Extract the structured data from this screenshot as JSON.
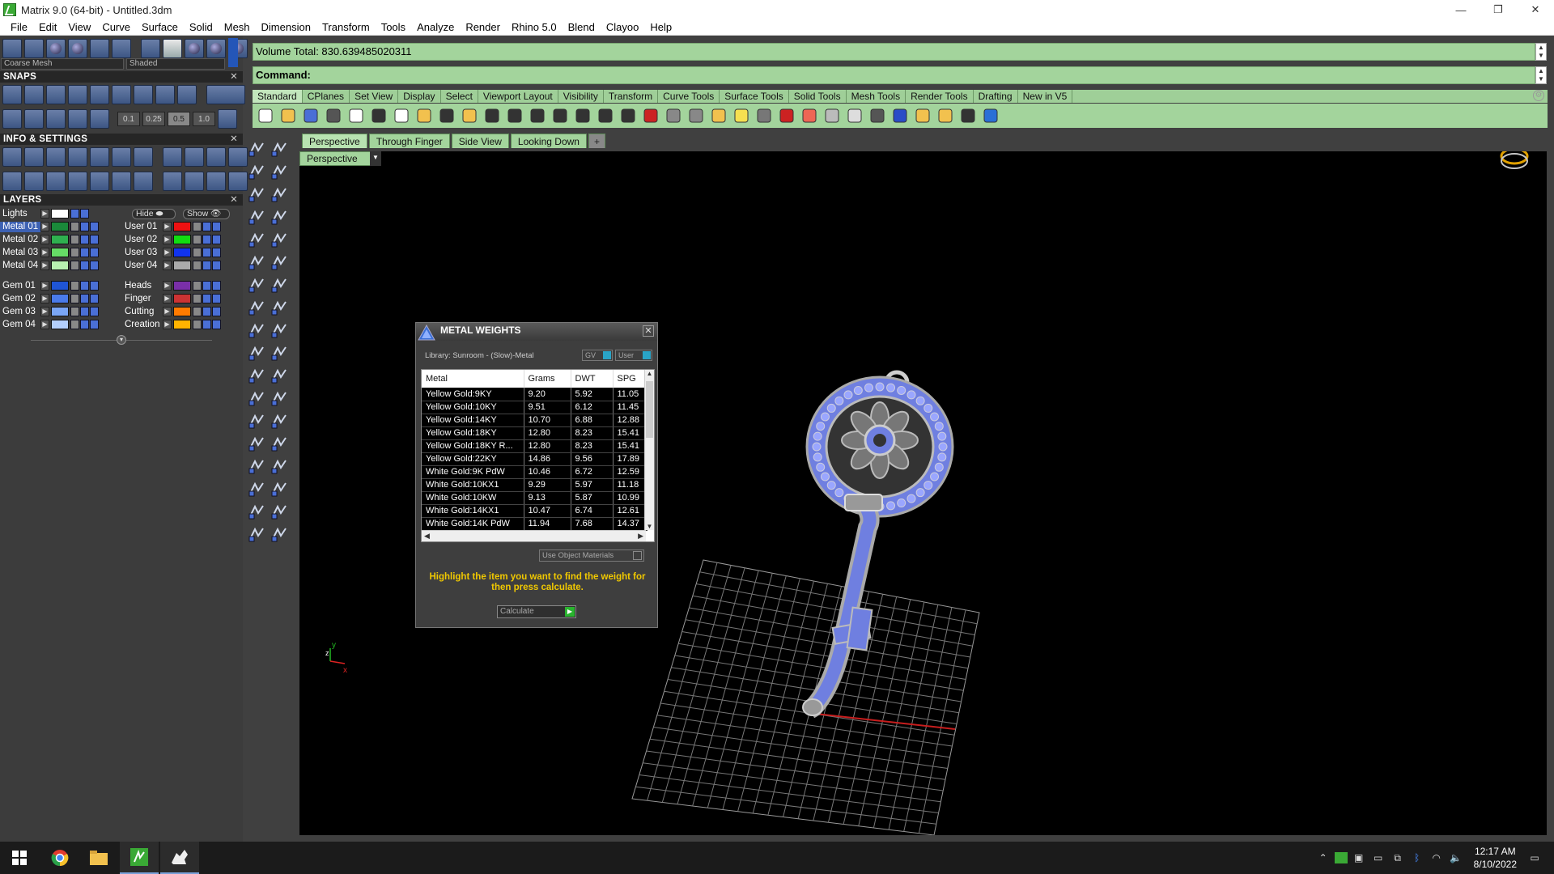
{
  "window": {
    "title": "Matrix 9.0 (64-bit) - Untitled.3dm",
    "minimize": "—",
    "restore": "❐",
    "close": "✕"
  },
  "menubar": [
    "File",
    "Edit",
    "View",
    "Curve",
    "Surface",
    "Solid",
    "Mesh",
    "Dimension",
    "Transform",
    "Tools",
    "Analyze",
    "Render",
    "Rhino 5.0",
    "Blend",
    "Clayoo",
    "Help"
  ],
  "left_panel": {
    "mesh_dropdown": "Coarse Mesh",
    "shading_dropdown": "Shaded",
    "snaps_header": "SNAPS",
    "snap_values": [
      "0.1",
      "0.25",
      "0.5",
      "1.0"
    ],
    "snap_selected": "0.5",
    "info_header": "INFO & SETTINGS",
    "layers_header": "LAYERS",
    "lights_label": "Lights",
    "hide_label": "Hide",
    "show_label": "Show",
    "layers_left": [
      {
        "name": "Metal 01",
        "color": "#1a8a3a",
        "selected": true
      },
      {
        "name": "Metal 02",
        "color": "#2fb04f"
      },
      {
        "name": "Metal 03",
        "color": "#66dd66"
      },
      {
        "name": "Metal 04",
        "color": "#b8f0b0"
      },
      {
        "name": "Gem 01",
        "color": "#1f55d6"
      },
      {
        "name": "Gem 02",
        "color": "#4a7bea"
      },
      {
        "name": "Gem 03",
        "color": "#7aa6f5"
      },
      {
        "name": "Gem 04",
        "color": "#b3cffb"
      }
    ],
    "layers_right": [
      {
        "name": "User 01",
        "color": "#ee1111"
      },
      {
        "name": "User 02",
        "color": "#11dd11"
      },
      {
        "name": "User 03",
        "color": "#1133ee"
      },
      {
        "name": "User 04",
        "color": "#aaaaaa"
      },
      {
        "name": "Heads",
        "color": "#7a2fa8"
      },
      {
        "name": "Finger",
        "color": "#cc3333"
      },
      {
        "name": "Cutting",
        "color": "#ff7a00"
      },
      {
        "name": "Creation",
        "color": "#ffb300"
      }
    ]
  },
  "command": {
    "history_line": "Volume Total: 830.639485020311",
    "prompt": "Command:"
  },
  "toolbar_tabs": [
    "Standard",
    "CPlanes",
    "Set View",
    "Display",
    "Select",
    "Viewport Layout",
    "Visibility",
    "Transform",
    "Curve Tools",
    "Surface Tools",
    "Solid Tools",
    "Mesh Tools",
    "Render Tools",
    "Drafting",
    "New in V5"
  ],
  "toolbar_active_tab": "Standard",
  "viewport": {
    "tabs": [
      "Perspective",
      "Through Finger",
      "Side View",
      "Looking Down"
    ],
    "active_tab": "Perspective",
    "add_tab": "+",
    "label": "Perspective",
    "axis_x": "x",
    "axis_y": "y",
    "axis_z": "z"
  },
  "metal_weights": {
    "title": "METAL WEIGHTS",
    "library": "Library: Sunroom - (Slow)-Metal",
    "gv_label": "GV",
    "user_label": "User",
    "columns": [
      "Metal",
      "Grams",
      "DWT",
      "SPG"
    ],
    "rows": [
      [
        "Yellow Gold:9KY",
        "9.20",
        "5.92",
        "11.05"
      ],
      [
        "Yellow Gold:10KY",
        "9.51",
        "6.12",
        "11.45"
      ],
      [
        "Yellow Gold:14KY",
        "10.70",
        "6.88",
        "12.88"
      ],
      [
        "Yellow Gold:18KY",
        "12.80",
        "8.23",
        "15.41"
      ],
      [
        "Yellow Gold:18KY R...",
        "12.80",
        "8.23",
        "15.41"
      ],
      [
        "Yellow Gold:22KY",
        "14.86",
        "9.56",
        "17.89"
      ],
      [
        "White Gold:9K PdW",
        "10.46",
        "6.72",
        "12.59"
      ],
      [
        "White Gold:10KX1",
        "9.29",
        "5.97",
        "11.18"
      ],
      [
        "White Gold:10KW",
        "9.13",
        "5.87",
        "10.99"
      ],
      [
        "White Gold:14KX1",
        "10.47",
        "6.74",
        "12.61"
      ],
      [
        "White Gold:14K PdW",
        "11.94",
        "7.68",
        "14.37"
      ]
    ],
    "use_object_materials": "Use Object Materials",
    "hint": "Highlight the item you want to find the weight for then press calculate.",
    "calculate": "Calculate"
  },
  "taskbar": {
    "time": "12:17 AM",
    "date": "8/10/2022"
  }
}
